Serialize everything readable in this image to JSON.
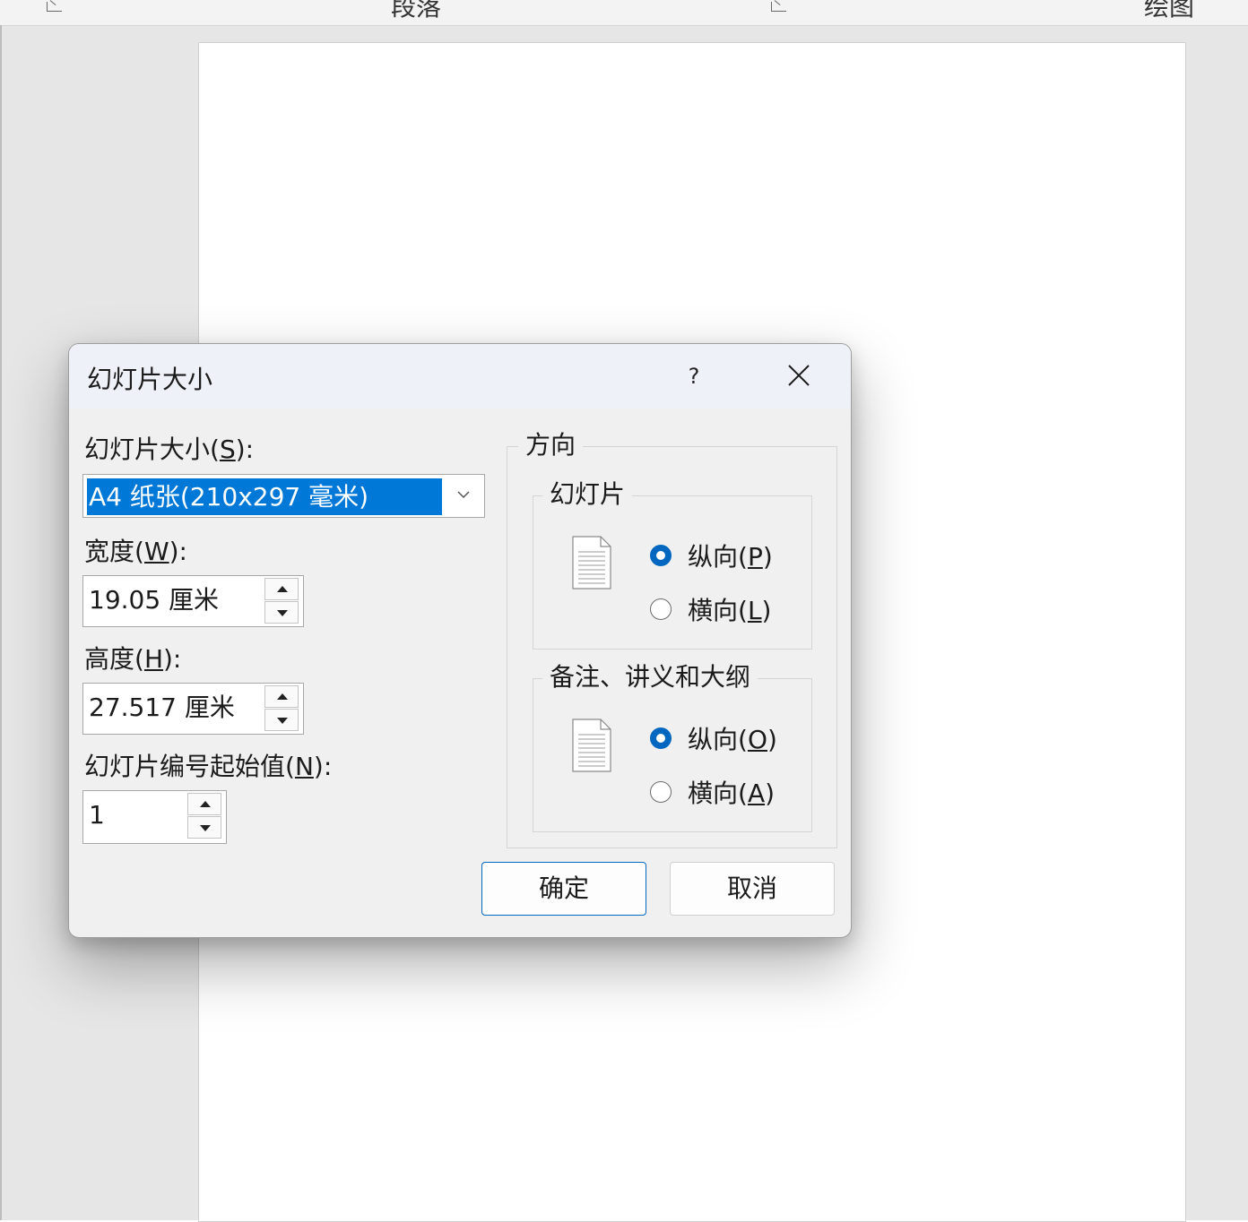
{
  "ribbon": {
    "groups": [
      "段落",
      "绘图"
    ]
  },
  "dialog": {
    "title": "幻灯片大小",
    "help_label": "?",
    "size": {
      "label_main": "幻灯片大小(",
      "label_key": "S",
      "label_end": "):",
      "selected": "A4 纸张(210x297 毫米)"
    },
    "width": {
      "label_main": "宽度(",
      "label_key": "W",
      "label_end": "):",
      "value": "19.05 厘米"
    },
    "height": {
      "label_main": "高度(",
      "label_key": "H",
      "label_end": "):",
      "value": "27.517 厘米"
    },
    "start_number": {
      "label_main": "幻灯片编号起始值(",
      "label_key": "N",
      "label_end": "):",
      "value": "1"
    },
    "orientation": {
      "title": "方向",
      "slides": {
        "title": "幻灯片",
        "portrait": {
          "main": "纵向(",
          "key": "P",
          "end": ")",
          "checked": true
        },
        "landscape": {
          "main": "横向(",
          "key": "L",
          "end": ")",
          "checked": false
        }
      },
      "notes": {
        "title": "备注、讲义和大纲",
        "portrait": {
          "main": "纵向(",
          "key": "O",
          "end": ")",
          "checked": true
        },
        "landscape": {
          "main": "横向(",
          "key": "A",
          "end": ")",
          "checked": false
        }
      }
    },
    "ok_label": "确定",
    "cancel_label": "取消"
  },
  "colors": {
    "accent": "#0067c0",
    "selection": "#0078d7"
  }
}
